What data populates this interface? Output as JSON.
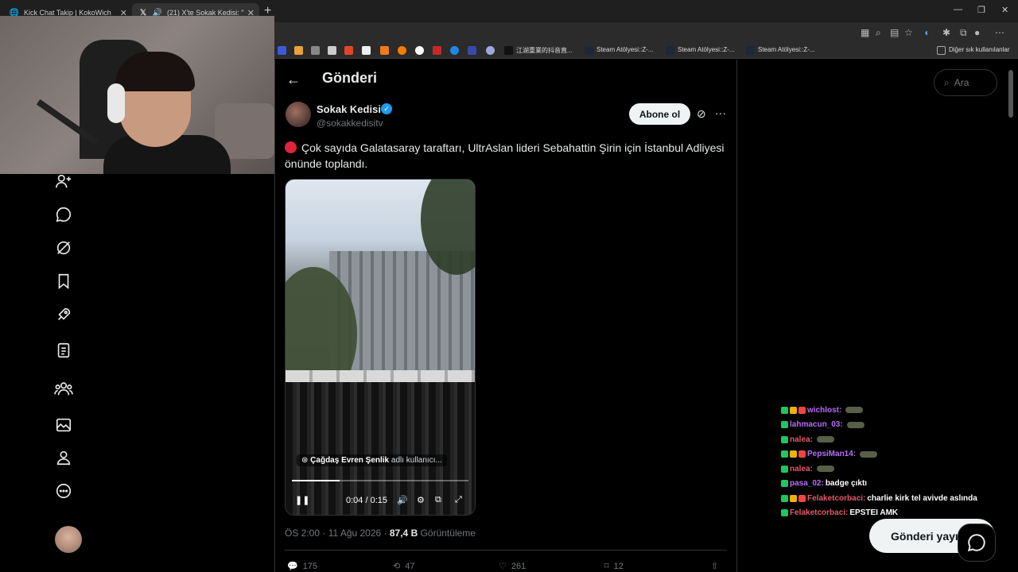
{
  "browser": {
    "tabs": [
      {
        "title": "Kick Chat Takip | KokoWich"
      },
      {
        "title": "(21) X'te Sokak Kedisi: \""
      }
    ],
    "bookmarks": [
      {
        "label": "江湖重業的抖音直..."
      },
      {
        "label": "Steam Atölyesi::Z-..."
      },
      {
        "label": "Steam Atölyesi::Z-..."
      },
      {
        "label": "Steam Atölyesi::Z-..."
      }
    ],
    "other_bookmarks": "Diğer sık kullanılanlar"
  },
  "page": {
    "title": "Gönderi",
    "search_placeholder": "Ara",
    "post_button": "Gönderi yayı"
  },
  "tweet": {
    "author_name": "Sokak Kedisi",
    "handle": "@sokakkedisitv",
    "subscribe_label": "Abone ol",
    "text": "Çok sayıda Galatasaray taraftarı, UltrAslan lideri Sebahattin Şirin için İstanbul Adliyesi önünde toplandı.",
    "video": {
      "credit_name": "Çağdaş Evren Şenlik",
      "credit_suffix": "adlı kullanıcı...",
      "time": "0:04 / 0:15",
      "progress": 0.27
    },
    "timestamp": "ÖS 2:00 · 11 Ağu 2026",
    "views_count": "87,4 B",
    "views_label": "Görüntüleme",
    "stats": {
      "replies": "175",
      "reposts": "47",
      "likes": "261",
      "bookmarks": "12"
    }
  },
  "chat": [
    {
      "user": "wichlost:",
      "color": "#b76cf5",
      "message": ""
    },
    {
      "user": "lahmacun_03:",
      "color": "#b76cf5",
      "message": ""
    },
    {
      "user": "nalea:",
      "color": "#e35b6b",
      "message": ""
    },
    {
      "user": "PepsiMan14:",
      "color": "#b76cf5",
      "message": ""
    },
    {
      "user": "nalea:",
      "color": "#e35b6b",
      "message": ""
    },
    {
      "user": "pasa_02:",
      "color": "#b76cf5",
      "message": "badge çıktı"
    },
    {
      "user": "Felaketcorbaci:",
      "color": "#e35b6b",
      "message": "charlie kirk tel avivde aslında"
    },
    {
      "user": "Felaketcorbaci:",
      "color": "#e35b6b",
      "message": "EPSTEI AMK"
    }
  ]
}
